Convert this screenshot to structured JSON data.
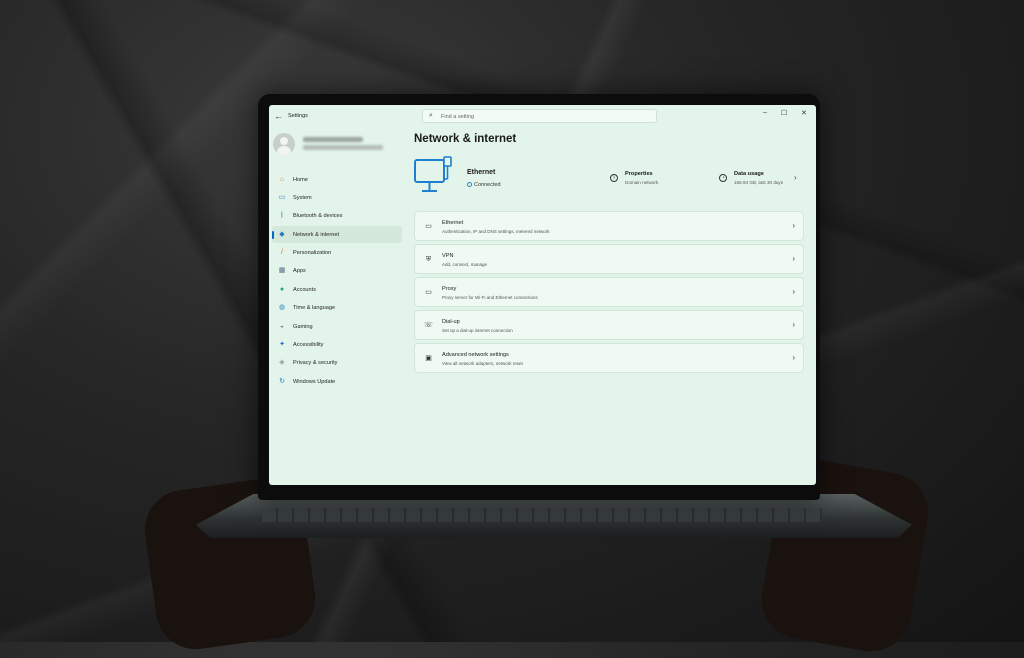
{
  "window": {
    "title": "Settings",
    "search_placeholder": "Find a setting"
  },
  "sidebar": {
    "items": [
      {
        "label": "Home",
        "icon": "home-icon",
        "color": "#d4843a"
      },
      {
        "label": "System",
        "icon": "system-icon",
        "color": "#2b79c4"
      },
      {
        "label": "Bluetooth & devices",
        "icon": "bluetooth-icon",
        "color": "#2b79c4"
      },
      {
        "label": "Network & internet",
        "icon": "wifi-icon",
        "color": "#2b79c4",
        "active": true
      },
      {
        "label": "Personalization",
        "icon": "brush-icon",
        "color": "#d0702e"
      },
      {
        "label": "Apps",
        "icon": "apps-icon",
        "color": "#5a6b88"
      },
      {
        "label": "Accounts",
        "icon": "person-icon",
        "color": "#2aa27a"
      },
      {
        "label": "Time & language",
        "icon": "globe-clock-icon",
        "color": "#2b88c8"
      },
      {
        "label": "Gaming",
        "icon": "gamepad-icon",
        "color": "#7b8a93"
      },
      {
        "label": "Accessibility",
        "icon": "accessibility-icon",
        "color": "#1f6fbf"
      },
      {
        "label": "Privacy & security",
        "icon": "shield-icon",
        "color": "#8a9199"
      },
      {
        "label": "Windows Update",
        "icon": "update-icon",
        "color": "#1f7fd0"
      }
    ]
  },
  "main": {
    "title": "Network & internet",
    "hero": {
      "name": "Ethernet",
      "status": "Connected",
      "properties_title": "Properties",
      "properties_sub": "Domain network",
      "usage_title": "Data usage",
      "usage_sub": "166.94 GB, last 30 days"
    },
    "rows": [
      {
        "title": "Ethernet",
        "sub": "Authentication, IP and DNS settings, metered network",
        "icon": "ethernet-icon"
      },
      {
        "title": "VPN",
        "sub": "Add, connect, manage",
        "icon": "vpn-shield-icon"
      },
      {
        "title": "Proxy",
        "sub": "Proxy server for Wi-Fi and Ethernet connections",
        "icon": "proxy-icon"
      },
      {
        "title": "Dial-up",
        "sub": "Set up a dial-up internet connection",
        "icon": "dialup-icon"
      },
      {
        "title": "Advanced network settings",
        "sub": "View all network adapters, network reset",
        "icon": "advanced-network-icon"
      }
    ]
  },
  "colors": {
    "screen_bg": "#e3f5ea",
    "accent": "#0067c0",
    "hero_icon": "#1f7fd0"
  }
}
